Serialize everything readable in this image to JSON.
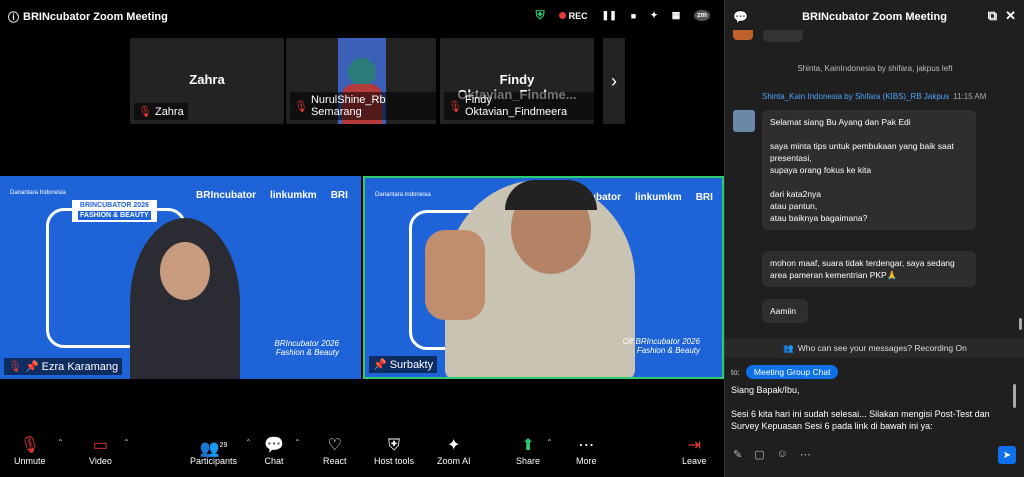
{
  "window": {
    "title": "BRINcubator Zoom Meeting",
    "rec_label": "REC",
    "avatar_initials": "zm"
  },
  "thumbnails": [
    {
      "center_name": "Zahra",
      "label": "Zahra"
    },
    {
      "center_name": "",
      "label": "NurulShine_Rb Semarang"
    },
    {
      "center_name": "Findy Oktavian_Findme...",
      "label": "Findy Oktavian_Findmeera"
    }
  ],
  "videos": [
    {
      "label": "Ezra Karamang",
      "brand": [
        "BRIncubator",
        "linkumkm",
        "BRI"
      ],
      "banner": "BRINCUBATOR 2026",
      "banner_sub": "FASHION & BEAUTY",
      "caption_1": "BRIncubator 2026",
      "caption_2": "Fashion & Beauty",
      "org": "Danantara Indonesia"
    },
    {
      "label": "Surbakty",
      "brand": [
        "BRIncubator",
        "linkumkm",
        "BRI"
      ],
      "caption_1": "Off BRIncubator 2026",
      "caption_2": "Fashion & Beauty",
      "org": "Danantara Indonesia"
    }
  ],
  "toolbar": {
    "unmute": "Unmute",
    "video": "Video",
    "participants": "Participants",
    "participants_count": "29",
    "chat": "Chat",
    "react": "React",
    "host_tools": "Host tools",
    "zoom_ai": "Zoom AI",
    "share": "Share",
    "more": "More",
    "leave": "Leave"
  },
  "panel": {
    "title": "BRINcubator Zoom Meeting",
    "system_message": "Shinta, KainIndonesia by shifara, jakpus left",
    "sender": "Shinta_Kain Indonesia by Shifara (KIBS)_RB Jakpus",
    "time": "11:15 AM",
    "messages": [
      "Selamat siang Bu Ayang dan Pak Edi\n\nsaya minta tips untuk pembukaan yang baik saat presentasi,\nsupaya orang fokus ke kita\n\ndari kata2nya\natau pantun,\natau baiknya bagaimana?",
      "mohon maaf, suara tidak terdengar, saya sedang area pameran kementrian PKP🙏",
      "Aamiin"
    ],
    "who_can_see": "Who can see your messages? Recording On",
    "to_label": "to:",
    "recipient": "Meeting Group Chat",
    "compose_text": "Siang Bapak/Ibu,\n\nSesi 6 kita hari ini sudah selesai... Silakan mengisi Post-Test dan Survey Kepuasan Sesi 6 pada link di bawah ini ya:"
  },
  "colors": {
    "accent": "#0e71eb",
    "video_bg": "#1e64d8",
    "active_border": "#2ecc71",
    "mute": "#e53935"
  }
}
